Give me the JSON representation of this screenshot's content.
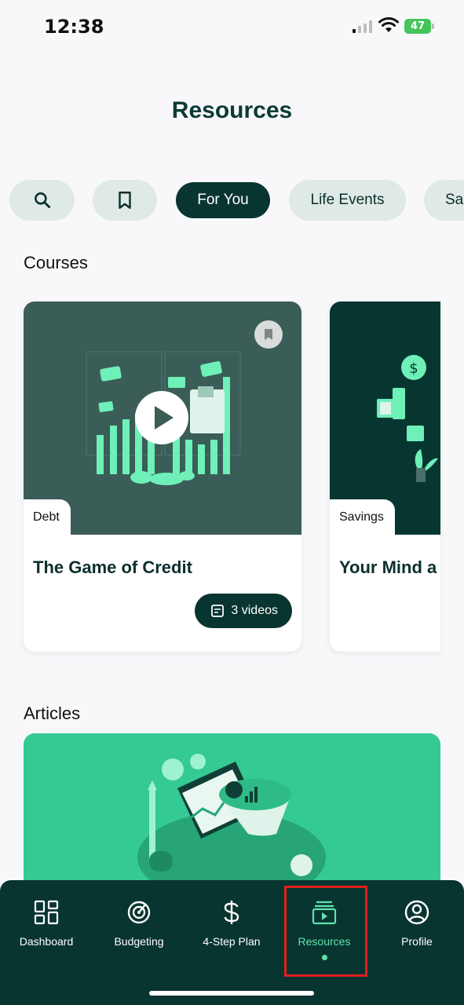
{
  "status": {
    "time": "12:38",
    "battery": "47"
  },
  "page": {
    "title": "Resources"
  },
  "filters": {
    "search_icon": "search-icon",
    "bookmark_icon": "bookmark-icon",
    "chips": [
      "For You",
      "Life Events",
      "Sa"
    ]
  },
  "courses": {
    "heading": "Courses",
    "items": [
      {
        "tag": "Debt",
        "title": "The Game of Credit",
        "videos": "3 videos"
      },
      {
        "tag": "Savings",
        "title": "Your Mind a"
      }
    ]
  },
  "articles": {
    "heading": "Articles"
  },
  "nav": {
    "items": [
      {
        "label": "Dashboard",
        "icon": "dashboard-icon"
      },
      {
        "label": "Budgeting",
        "icon": "budgeting-icon"
      },
      {
        "label": "4-Step Plan",
        "icon": "dollar-icon"
      },
      {
        "label": "Resources",
        "icon": "resources-icon"
      },
      {
        "label": "Profile",
        "icon": "profile-icon"
      }
    ],
    "active": "Resources"
  },
  "colors": {
    "primary": "#093530",
    "accent": "#5fe3ad",
    "article_bg": "#35c994",
    "chip_bg": "#dfe9e6"
  }
}
